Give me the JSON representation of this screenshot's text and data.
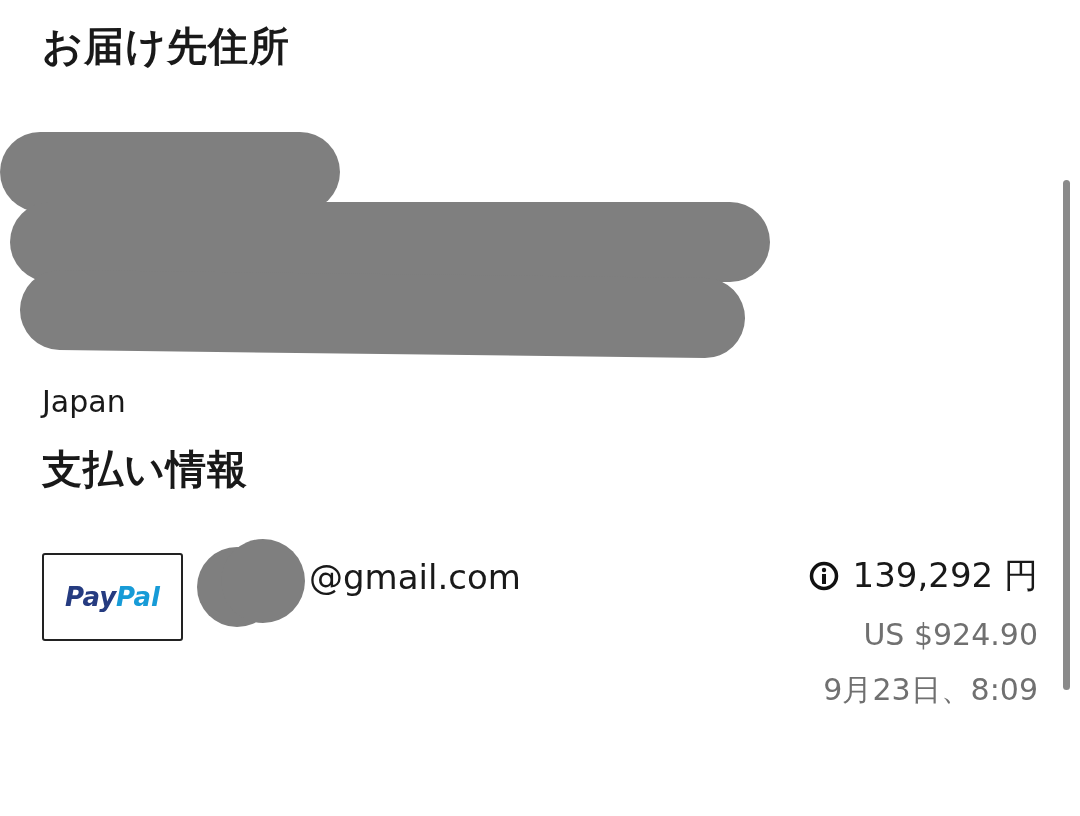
{
  "shipping": {
    "title": "お届け先住所",
    "address_redacted": true,
    "country": "Japan"
  },
  "payment": {
    "title": "支払い情報",
    "method": {
      "kind": "paypal",
      "logo_part1": "Pay",
      "logo_part2": "Pal"
    },
    "email": {
      "redacted": true,
      "text": "@gmail.com"
    },
    "amount": "139,292 円",
    "amount_usd": "US $924.90",
    "date": "9月23日、8:09"
  }
}
